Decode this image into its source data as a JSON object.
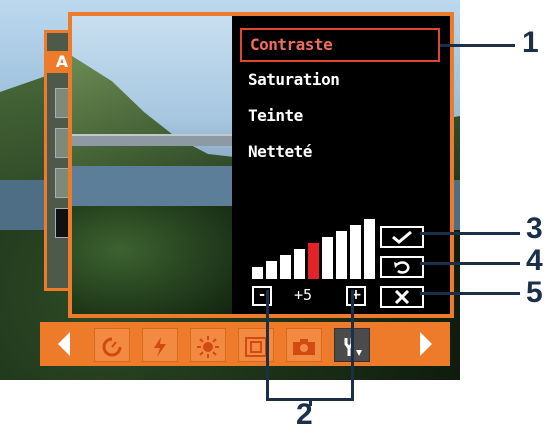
{
  "menu": {
    "items": [
      {
        "label": "Contraste",
        "selected": true
      },
      {
        "label": "Saturation",
        "selected": false
      },
      {
        "label": "Teinte",
        "selected": false
      },
      {
        "label": "Netteté",
        "selected": false
      }
    ]
  },
  "adjust": {
    "minus_label": "-",
    "plus_label": "+",
    "value": "+5",
    "levels_total": 9,
    "level_active": 4
  },
  "buttons": {
    "confirm_icon": "check-icon",
    "reset_icon": "undo-icon",
    "cancel_icon": "close-icon"
  },
  "back_panel": {
    "tab_label": "A"
  },
  "toolbar": {
    "icons": [
      "timer-icon",
      "flash-icon",
      "brightness-icon",
      "image-size-icon",
      "camera-icon",
      "tools-icon"
    ],
    "active_icon": "tools-icon"
  },
  "callouts": {
    "c1": "1",
    "c2": "2",
    "c3": "3",
    "c4": "4",
    "c5": "5"
  },
  "colors": {
    "accent": "#ee7b29",
    "selected_text": "#f26b5e",
    "active_level": "#e4222a",
    "callout": "#1b2e4a"
  }
}
